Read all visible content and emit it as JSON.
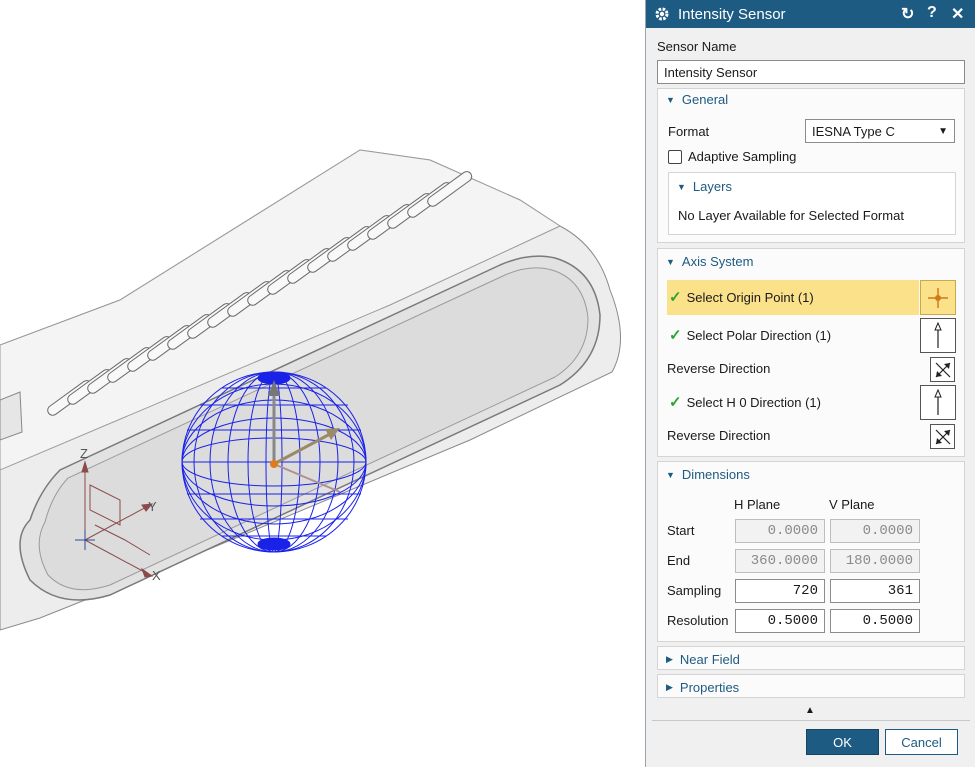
{
  "viewport": {
    "axis_labels": {
      "z": "Z",
      "y": "Y",
      "x": "X"
    }
  },
  "dialog": {
    "title": "Intensity Sensor",
    "sensor_name_label": "Sensor Name",
    "sensor_name_value": "Intensity Sensor",
    "general": {
      "header": "General",
      "format_label": "Format",
      "format_value": "IESNA Type C",
      "adaptive_sampling_label": "Adaptive Sampling",
      "adaptive_sampling_checked": false,
      "layers": {
        "header": "Layers",
        "message": "No Layer Available for Selected Format"
      }
    },
    "axis_system": {
      "header": "Axis System",
      "origin_point_label": "Select Origin Point (1)",
      "polar_direction_label": "Select Polar Direction (1)",
      "reverse_direction_1": "Reverse Direction",
      "h0_direction_label": "Select H 0 Direction (1)",
      "reverse_direction_2": "Reverse Direction"
    },
    "dimensions": {
      "header": "Dimensions",
      "col_h": "H Plane",
      "col_v": "V Plane",
      "rows": [
        {
          "label": "Start",
          "h": "0.0000",
          "v": "0.0000"
        },
        {
          "label": "End",
          "h": "360.0000",
          "v": "180.0000"
        },
        {
          "label": "Sampling",
          "h": "720",
          "v": "361"
        },
        {
          "label": "Resolution",
          "h": "0.5000",
          "v": "0.5000"
        }
      ]
    },
    "near_field_header": "Near Field",
    "properties_header": "Properties",
    "ok_label": "OK",
    "cancel_label": "Cancel",
    "colors": {
      "title_bar": "#1d5b82",
      "accent_text": "#1d5b82",
      "selected_row": "#fbe28a",
      "check": "#2aa530"
    }
  }
}
